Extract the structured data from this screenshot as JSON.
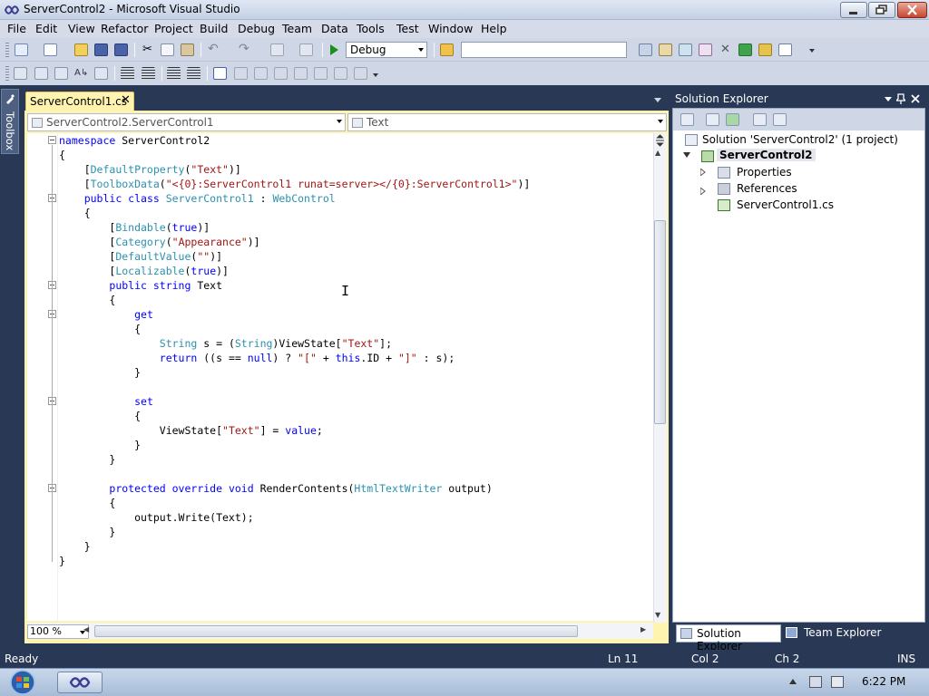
{
  "window": {
    "title": "ServerControl2 - Microsoft Visual Studio"
  },
  "menu": [
    "File",
    "Edit",
    "View",
    "Refactor",
    "Project",
    "Build",
    "Debug",
    "Team",
    "Data",
    "Tools",
    "Test",
    "Window",
    "Help"
  ],
  "toolbar": {
    "config": "Debug",
    "find_value": ""
  },
  "toolbox": {
    "label": "Toolbox"
  },
  "editor": {
    "tab_label": "ServerControl1.cs",
    "tab_close": "✕",
    "nav_type": "ServerControl2.ServerControl1",
    "nav_member": "Text",
    "zoom": "100 %",
    "code_lines": [
      [
        {
          "t": "namespace ",
          "c": "kw"
        },
        {
          "t": "ServerControl2"
        }
      ],
      [
        {
          "t": "{"
        }
      ],
      [
        {
          "t": "    ["
        },
        {
          "t": "DefaultProperty",
          "c": "ty"
        },
        {
          "t": "("
        },
        {
          "t": "\"Text\"",
          "c": "st"
        },
        {
          "t": ")]"
        }
      ],
      [
        {
          "t": "    ["
        },
        {
          "t": "ToolboxData",
          "c": "ty"
        },
        {
          "t": "("
        },
        {
          "t": "\"<{0}:ServerControl1 runat=server></{0}:ServerControl1>\"",
          "c": "st"
        },
        {
          "t": ")]"
        }
      ],
      [
        {
          "t": "    "
        },
        {
          "t": "public class ",
          "c": "kw"
        },
        {
          "t": "ServerControl1",
          "c": "ty"
        },
        {
          "t": " : "
        },
        {
          "t": "WebControl",
          "c": "ty"
        }
      ],
      [
        {
          "t": "    {"
        }
      ],
      [
        {
          "t": "        ["
        },
        {
          "t": "Bindable",
          "c": "ty"
        },
        {
          "t": "("
        },
        {
          "t": "true",
          "c": "kw"
        },
        {
          "t": ")]"
        }
      ],
      [
        {
          "t": "        ["
        },
        {
          "t": "Category",
          "c": "ty"
        },
        {
          "t": "("
        },
        {
          "t": "\"Appearance\"",
          "c": "st"
        },
        {
          "t": ")]"
        }
      ],
      [
        {
          "t": "        ["
        },
        {
          "t": "DefaultValue",
          "c": "ty"
        },
        {
          "t": "("
        },
        {
          "t": "\"\"",
          "c": "st"
        },
        {
          "t": ")]"
        }
      ],
      [
        {
          "t": "        ["
        },
        {
          "t": "Localizable",
          "c": "ty"
        },
        {
          "t": "("
        },
        {
          "t": "true",
          "c": "kw"
        },
        {
          "t": ")]"
        }
      ],
      [
        {
          "t": "        "
        },
        {
          "t": "public string ",
          "c": "kw"
        },
        {
          "t": "Text"
        }
      ],
      [
        {
          "t": "        {"
        }
      ],
      [
        {
          "t": "            "
        },
        {
          "t": "get",
          "c": "kw"
        }
      ],
      [
        {
          "t": "            {"
        }
      ],
      [
        {
          "t": "                "
        },
        {
          "t": "String",
          "c": "ty"
        },
        {
          "t": " s = ("
        },
        {
          "t": "String",
          "c": "ty"
        },
        {
          "t": ")ViewState["
        },
        {
          "t": "\"Text\"",
          "c": "st"
        },
        {
          "t": "];"
        }
      ],
      [
        {
          "t": "                "
        },
        {
          "t": "return",
          "c": "kw"
        },
        {
          "t": " ((s == "
        },
        {
          "t": "null",
          "c": "kw"
        },
        {
          "t": ") ? "
        },
        {
          "t": "\"[\"",
          "c": "st"
        },
        {
          "t": " + "
        },
        {
          "t": "this",
          "c": "kw"
        },
        {
          "t": ".ID + "
        },
        {
          "t": "\"]\"",
          "c": "st"
        },
        {
          "t": " : s);"
        }
      ],
      [
        {
          "t": "            }"
        }
      ],
      [
        {
          "t": ""
        }
      ],
      [
        {
          "t": "            "
        },
        {
          "t": "set",
          "c": "kw"
        }
      ],
      [
        {
          "t": "            {"
        }
      ],
      [
        {
          "t": "                ViewState["
        },
        {
          "t": "\"Text\"",
          "c": "st"
        },
        {
          "t": "] = "
        },
        {
          "t": "value",
          "c": "kw"
        },
        {
          "t": ";"
        }
      ],
      [
        {
          "t": "            }"
        }
      ],
      [
        {
          "t": "        }"
        }
      ],
      [
        {
          "t": ""
        }
      ],
      [
        {
          "t": "        "
        },
        {
          "t": "protected override void ",
          "c": "kw"
        },
        {
          "t": "RenderContents("
        },
        {
          "t": "HtmlTextWriter",
          "c": "ty"
        },
        {
          "t": " output)"
        }
      ],
      [
        {
          "t": "        {"
        }
      ],
      [
        {
          "t": "            output.Write(Text);"
        }
      ],
      [
        {
          "t": "        }"
        }
      ],
      [
        {
          "t": "    }"
        }
      ],
      [
        {
          "t": "}"
        }
      ]
    ],
    "fold_lines": [
      0,
      4,
      10,
      12,
      18,
      24
    ]
  },
  "solution_explorer": {
    "title": "Solution Explorer",
    "solution": "Solution 'ServerControl2' (1 project)",
    "project": "ServerControl2",
    "items": [
      "Properties",
      "References",
      "ServerControl1.cs"
    ],
    "tab_active": "Solution Explorer",
    "tab_other": "Team Explorer"
  },
  "status": {
    "ready": "Ready",
    "ln": "Ln 11",
    "col": "Col 2",
    "ch": "Ch 2",
    "mode": "INS"
  },
  "taskbar": {
    "clock": "6:22 PM"
  },
  "colors": {
    "keyword": "#0000ff",
    "type": "#2b91af",
    "string": "#a31515",
    "chrome": "#293955",
    "tab_active": "#fff3b0"
  }
}
